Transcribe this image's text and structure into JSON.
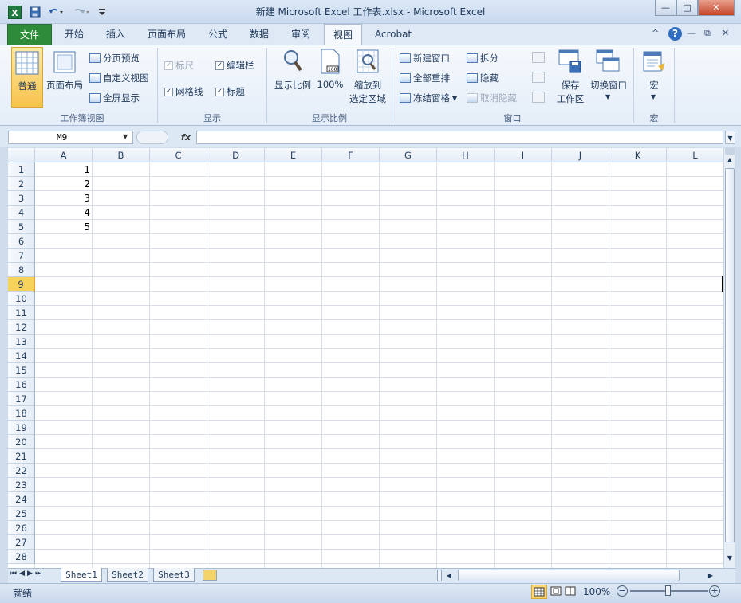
{
  "window": {
    "title": "新建 Microsoft Excel 工作表.xlsx - Microsoft Excel",
    "minimize_label": "—",
    "maximize_label": "□",
    "close_label": "✕"
  },
  "quick_access": {
    "logo": "X",
    "save_icon": "save-icon",
    "undo_icon": "undo-icon",
    "redo_icon": "redo-icon"
  },
  "tabs": [
    {
      "label": "文件"
    },
    {
      "label": "开始"
    },
    {
      "label": "插入"
    },
    {
      "label": "页面布局"
    },
    {
      "label": "公式"
    },
    {
      "label": "数据"
    },
    {
      "label": "审阅"
    },
    {
      "label": "视图"
    },
    {
      "label": "Acrobat"
    }
  ],
  "ribbon": {
    "workbook_views": {
      "label": "工作簿视图",
      "normal": "普通",
      "page_layout": "页面布局",
      "page_break": "分页预览",
      "custom_views": "自定义视图",
      "full_screen": "全屏显示"
    },
    "show": {
      "label": "显示",
      "ruler": "标尺",
      "formula_bar": "编辑栏",
      "gridlines": "网格线",
      "headings": "标题"
    },
    "zoom": {
      "label": "显示比例",
      "zoom": "显示比例",
      "hundred": "100%",
      "zoom_sel_1": "缩放到",
      "zoom_sel_2": "选定区域"
    },
    "window": {
      "label": "窗口",
      "new_window": "新建窗口",
      "arrange_all": "全部重排",
      "freeze": "冻结窗格",
      "split": "拆分",
      "hide": "隐藏",
      "unhide": "取消隐藏",
      "save_ws_1": "保存",
      "save_ws_2": "工作区",
      "switch": "切换窗口"
    },
    "macros": {
      "label": "宏",
      "macros": "宏"
    }
  },
  "formula_bar": {
    "name_box": "M9",
    "fx": "fx",
    "content": ""
  },
  "columns": [
    "A",
    "B",
    "C",
    "D",
    "E",
    "F",
    "G",
    "H",
    "I",
    "J",
    "K",
    "L"
  ],
  "rows": [
    "1",
    "2",
    "3",
    "4",
    "5",
    "6",
    "7",
    "8",
    "9",
    "10",
    "11",
    "12",
    "13",
    "14",
    "15",
    "16",
    "17",
    "18",
    "19",
    "20",
    "21",
    "22",
    "23",
    "24",
    "25",
    "26",
    "27",
    "28"
  ],
  "cells": {
    "A1": "1",
    "A2": "2",
    "A3": "3",
    "A4": "4",
    "A5": "5"
  },
  "selected_row": "9",
  "sheets": [
    {
      "label": "Sheet1"
    },
    {
      "label": "Sheet2"
    },
    {
      "label": "Sheet3"
    }
  ],
  "status": {
    "ready": "就绪",
    "zoom": "100%"
  }
}
